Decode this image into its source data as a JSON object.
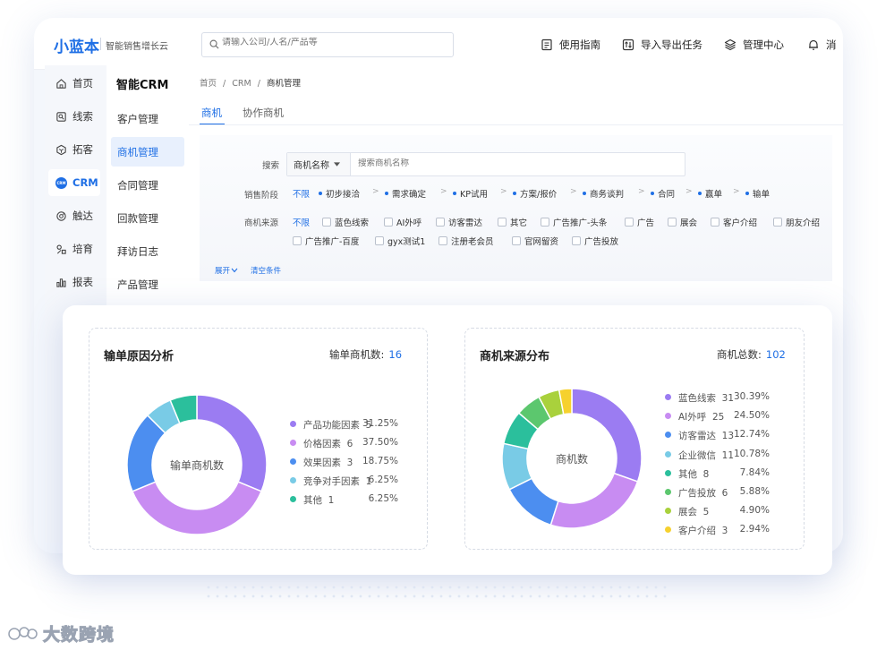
{
  "app": {
    "logo": "小蓝本",
    "slogan": "智能销售增长云"
  },
  "topbar": {
    "search_placeholder": "请输入公司/人名/产品等",
    "guide": "使用指南",
    "tasks": "导入导出任务",
    "admin": "管理中心",
    "notify": "消"
  },
  "rail": {
    "items": [
      {
        "label": "首页",
        "icon": "home-icon"
      },
      {
        "label": "线索",
        "icon": "leads-icon"
      },
      {
        "label": "拓客",
        "icon": "prospect-icon"
      },
      {
        "label": "CRM",
        "icon": "crm-icon"
      },
      {
        "label": "触达",
        "icon": "reach-icon"
      },
      {
        "label": "培育",
        "icon": "nurture-icon"
      },
      {
        "label": "报表",
        "icon": "report-icon"
      }
    ],
    "crm_badge": "CRM"
  },
  "subnav": {
    "title": "智能CRM",
    "items": [
      "客户管理",
      "商机管理",
      "合同管理",
      "回款管理",
      "拜访日志",
      "产品管理"
    ]
  },
  "breadcrumb": {
    "home": "首页",
    "sep": "/",
    "crm": "CRM",
    "current": "商机管理"
  },
  "tabs": [
    "商机",
    "协作商机"
  ],
  "filter": {
    "search_label": "搜索",
    "search_field": "商机名称",
    "search_placeholder": "搜索商机名称",
    "stage_label": "销售阶段",
    "stage_all": "不限",
    "stages": [
      "初步接洽",
      "需求确定",
      "KP试用",
      "方案/报价",
      "商务谈判",
      "合同",
      "赢单",
      "输单"
    ],
    "arrow": ">",
    "source_label": "商机来源",
    "source_all": "不限",
    "sources_row1": [
      "蓝色线索",
      "AI外呼",
      "访客雷达",
      "其它",
      "广告推广-头条",
      "广告",
      "展会",
      "客户介绍",
      "朋友介绍"
    ],
    "sources_row2": [
      "广告推广-百度",
      "gyx测试1",
      "注册老会员",
      "官网留资",
      "广告投放"
    ],
    "expand": "展开",
    "clear": "清空条件"
  },
  "left_panel": {
    "title": "输单原因分析",
    "stat_label": "输单商机数:",
    "stat_value": "16",
    "center": "输单商机数"
  },
  "right_panel": {
    "title": "商机来源分布",
    "stat_label": "商机总数:",
    "stat_value": "102",
    "center": "商机数"
  },
  "chart_data": [
    {
      "type": "pie",
      "title": "输单原因分析",
      "categories": [
        "产品功能因素",
        "价格因素",
        "效果因素",
        "竞争对手因素",
        "其他"
      ],
      "values": [
        5,
        6,
        3,
        1,
        1
      ],
      "percents": [
        "31.25%",
        "37.50%",
        "18.75%",
        "6.25%",
        "6.25%"
      ],
      "colors": [
        "#9b7cf2",
        "#c88cf2",
        "#4c8ef0",
        "#79cbe6",
        "#2bbf9c"
      ]
    },
    {
      "type": "pie",
      "title": "商机来源分布",
      "categories": [
        "蓝色线索",
        "AI外呼",
        "访客雷达",
        "企业微信",
        "其他",
        "广告投放",
        "展会",
        "客户介绍"
      ],
      "values": [
        31,
        25,
        13,
        11,
        8,
        6,
        5,
        3
      ],
      "percents": [
        "30.39%",
        "24.50%",
        "12.74%",
        "10.78%",
        "7.84%",
        "5.88%",
        "4.90%",
        "2.94%"
      ],
      "colors": [
        "#9b7cf2",
        "#c88cf2",
        "#4c8ef0",
        "#79cbe6",
        "#2bbf9c",
        "#5cc76e",
        "#a9d13c",
        "#f6d12e"
      ]
    }
  ],
  "watermark": "大数跨境"
}
